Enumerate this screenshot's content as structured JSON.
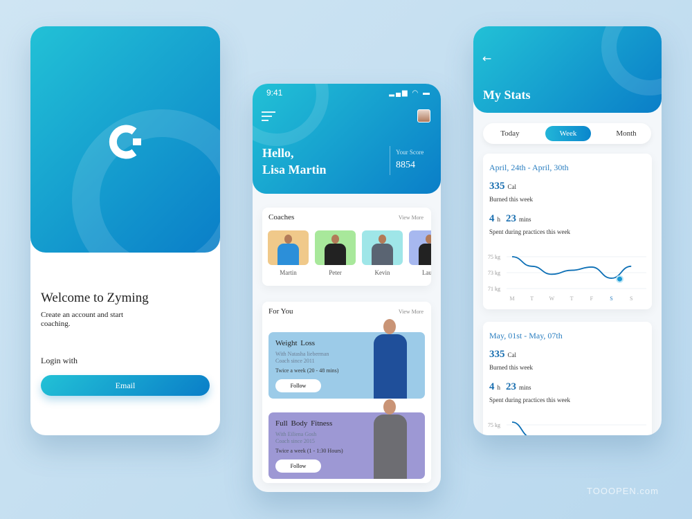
{
  "welcome": {
    "title": "Welcome  to  Zyming",
    "subtitle": "Create an account and start coaching.",
    "login_label": "Login with",
    "email_button": "Email"
  },
  "home": {
    "time": "9:41",
    "status_icons": "▂▄▆ ◠ ▬",
    "greeting": "Hello,",
    "name": "Lisa Martin",
    "score_label": "Your Score",
    "score": "8854",
    "coaches": {
      "title": "Coaches",
      "view_more": "View More",
      "items": [
        {
          "name": "Martin",
          "bg": "#f0c98a",
          "shirt": "#2c8fd9"
        },
        {
          "name": "Peter",
          "bg": "#a8e89b",
          "shirt": "#222"
        },
        {
          "name": "Kevin",
          "bg": "#9fe6e8",
          "shirt": "#5a6472"
        },
        {
          "name": "Laure",
          "bg": "#a7b8ef",
          "shirt": "#222"
        }
      ]
    },
    "for_you": {
      "title": "For You",
      "view_more": "View More",
      "items": [
        {
          "title": "Weight  Loss",
          "coach": "With Natasha lieberman",
          "since": "Coach since 2011",
          "frequency": "Twice a week (20 - 48 mins)",
          "button": "Follow",
          "bg": "#9ccbe8",
          "outfit": "#1f4f9a"
        },
        {
          "title": "Full  Body  Fitness",
          "coach": "With Eiliena Gosh",
          "since": "Coach since 2015",
          "frequency": "Twice a week (1 - 1:30 Hours)",
          "button": "Follow",
          "bg": "#9d98d4",
          "outfit": "#6d6d72"
        }
      ]
    }
  },
  "stats": {
    "back_icon": "arrow-left-icon",
    "title": "My Stats",
    "tabs": [
      "Today",
      "Week",
      "Month"
    ],
    "active_tab": "Week",
    "weeks": [
      {
        "range": "April, 24th - April, 30th",
        "calories": "335",
        "cal_unit": "Cal",
        "cal_label": "Burned this week",
        "hours": "4",
        "h_unit": "h",
        "mins": "23",
        "m_unit": "mins",
        "time_label": "Spent during practices this week"
      },
      {
        "range": "May, 01st - May, 07th",
        "calories": "335",
        "cal_unit": "Cal",
        "cal_label": "Burned this week",
        "hours": "4",
        "h_unit": "h",
        "mins": "23",
        "m_unit": "mins",
        "time_label": "Spent during practices this week"
      }
    ],
    "chart": {
      "type": "line",
      "y_ticks": [
        "75 kg",
        "73 kg",
        "71 kg"
      ],
      "ylim": [
        71,
        75
      ],
      "days": [
        "M",
        "T",
        "W",
        "T",
        "F",
        "S",
        "S"
      ],
      "highlight_day": 5,
      "values": [
        75,
        73.8,
        72.8,
        73.3,
        73.7,
        72.3,
        73.8
      ],
      "highlight_value": 72.2
    },
    "second_chart_tick": "75 kg"
  },
  "colors": {
    "accent": "#0a86cc",
    "accent_light": "#22c1d6",
    "background": "#c5dff0"
  },
  "watermark": "TOOOPEN.com"
}
